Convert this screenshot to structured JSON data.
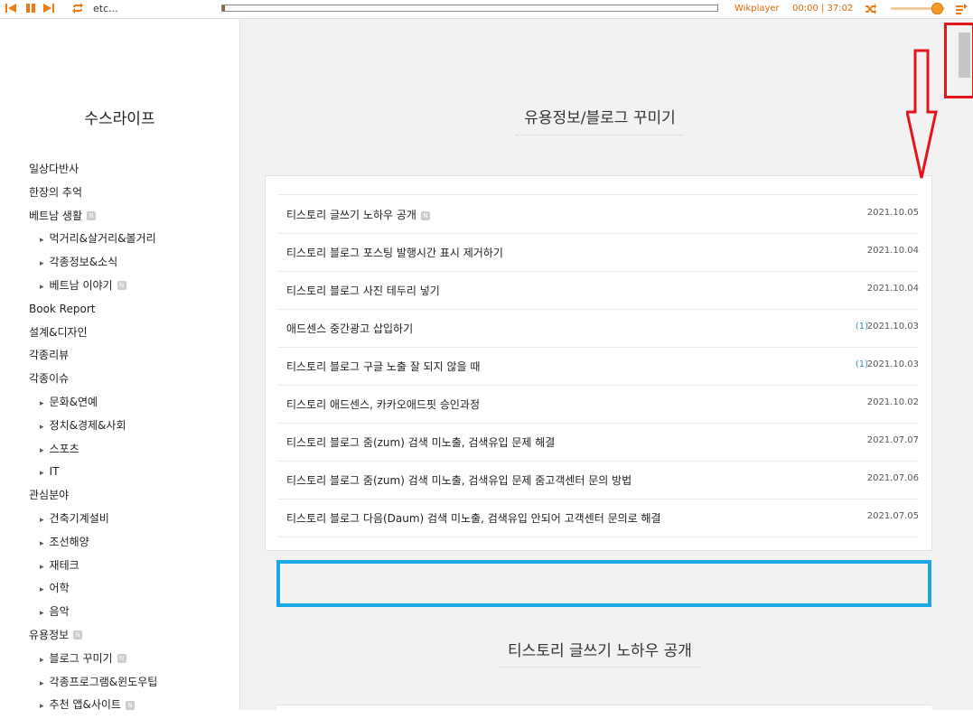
{
  "player": {
    "track": "etc...",
    "name": "Wikplayer",
    "time": "00:00 | 37:02",
    "progress": 0.005,
    "volume": 0.85,
    "accent": "#f58a1f"
  },
  "sidebar": {
    "blog_title": "수스라이프",
    "items": [
      {
        "label": "일상다반사",
        "level": 0,
        "new": false
      },
      {
        "label": "한장의 추억",
        "level": 0,
        "new": false
      },
      {
        "label": "베트남 생활",
        "level": 0,
        "new": true
      },
      {
        "label": "먹거리&살거리&볼거리",
        "level": 1,
        "new": false
      },
      {
        "label": "각종정보&소식",
        "level": 1,
        "new": false
      },
      {
        "label": "베트남 이야기",
        "level": 1,
        "new": true
      },
      {
        "label": "Book Report",
        "level": 0,
        "new": false
      },
      {
        "label": "설계&디자인",
        "level": 0,
        "new": false
      },
      {
        "label": "각종리뷰",
        "level": 0,
        "new": false
      },
      {
        "label": "각종이슈",
        "level": 0,
        "new": false
      },
      {
        "label": "문화&연예",
        "level": 1,
        "new": false
      },
      {
        "label": "정치&경제&사회",
        "level": 1,
        "new": false
      },
      {
        "label": "스포츠",
        "level": 1,
        "new": false
      },
      {
        "label": "IT",
        "level": 1,
        "new": false
      },
      {
        "label": "관심분야",
        "level": 0,
        "new": false
      },
      {
        "label": "건축기계설비",
        "level": 1,
        "new": false
      },
      {
        "label": "조선해양",
        "level": 1,
        "new": false
      },
      {
        "label": "재테크",
        "level": 1,
        "new": false
      },
      {
        "label": "어학",
        "level": 1,
        "new": false
      },
      {
        "label": "음악",
        "level": 1,
        "new": false
      },
      {
        "label": "유용정보",
        "level": 0,
        "new": true
      },
      {
        "label": "블로그 꾸미기",
        "level": 1,
        "new": true
      },
      {
        "label": "각종프로그램&윈도우팁",
        "level": 1,
        "new": false
      },
      {
        "label": "추천 앱&사이트",
        "level": 1,
        "new": true
      }
    ],
    "new_badge": "N"
  },
  "main": {
    "category_title": "유용정보/블로그 꾸미기",
    "posts": [
      {
        "title": "티스토리 글쓰기 노하우 공개",
        "new": true,
        "comments": "",
        "date": "2021.10.05"
      },
      {
        "title": "티스토리 블로그 포스팅 발행시간 표시 제거하기",
        "new": false,
        "comments": "",
        "date": "2021.10.04"
      },
      {
        "title": "티스토리 블로그 사진 테두리 넣기",
        "new": false,
        "comments": "",
        "date": "2021.10.04"
      },
      {
        "title": "애드센스 중간광고 삽입하기",
        "new": false,
        "comments": "(1)",
        "date": "2021.10.03"
      },
      {
        "title": "티스토리 블로그 구글 노출 잘 되지 않을 때",
        "new": false,
        "comments": "(1)",
        "date": "2021.10.03"
      },
      {
        "title": "티스토리 애드센스, 카카오애드핏 승인과정",
        "new": false,
        "comments": "",
        "date": "2021.10.02"
      },
      {
        "title": "티스토리 블로그 줌(zum) 검색 미노출, 검색유입 문제 해결",
        "new": false,
        "comments": "",
        "date": "2021.07.07"
      },
      {
        "title": "티스토리 블로그 줌(zum) 검색 미노출, 검색유입 문제 줌고객센터 문의 방법",
        "new": false,
        "comments": "",
        "date": "2021.07.06"
      },
      {
        "title": "티스토리 블로그 다음(Daum) 검색 미노출, 검색유입 안되어 고객센터 문의로 해결",
        "new": false,
        "comments": "",
        "date": "2021.07.05"
      }
    ],
    "post_title": "티스토리 글쓰기 노하우 공개"
  },
  "annotations": {
    "scroll_highlight_color": "#e4141b",
    "ad_highlight_color": "#1ba6e8"
  }
}
